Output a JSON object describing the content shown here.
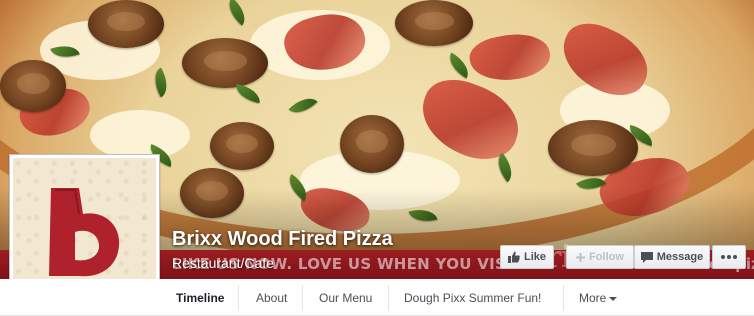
{
  "page": {
    "name": "Brixx Wood Fired Pizza",
    "category": "Restaurant/Cafe"
  },
  "cover": {
    "banner_text": "LIKE US NOW. LOVE US WHEN YOU VISIT.",
    "banner_brand": "Brixx",
    "banner_brand_sub": "wood fired pizza"
  },
  "profile_picture": {
    "logo_letter": "b",
    "logo_color": "#b0222b"
  },
  "actions": {
    "like_label": "Like",
    "follow_label": "Follow",
    "message_label": "Message",
    "more_icon": "more-dots-icon"
  },
  "nav": {
    "items": [
      {
        "label": "Timeline",
        "active": true
      },
      {
        "label": "About",
        "active": false
      },
      {
        "label": "Our Menu",
        "active": false
      },
      {
        "label": "Dough Pixx Summer Fun!",
        "active": false
      },
      {
        "label": "More",
        "active": false
      }
    ]
  },
  "colors": {
    "banner_red": "#8c171d",
    "nav_text": "#4b4f56",
    "nav_active_text": "#1d2129",
    "button_bg": "#f6f7f9"
  }
}
